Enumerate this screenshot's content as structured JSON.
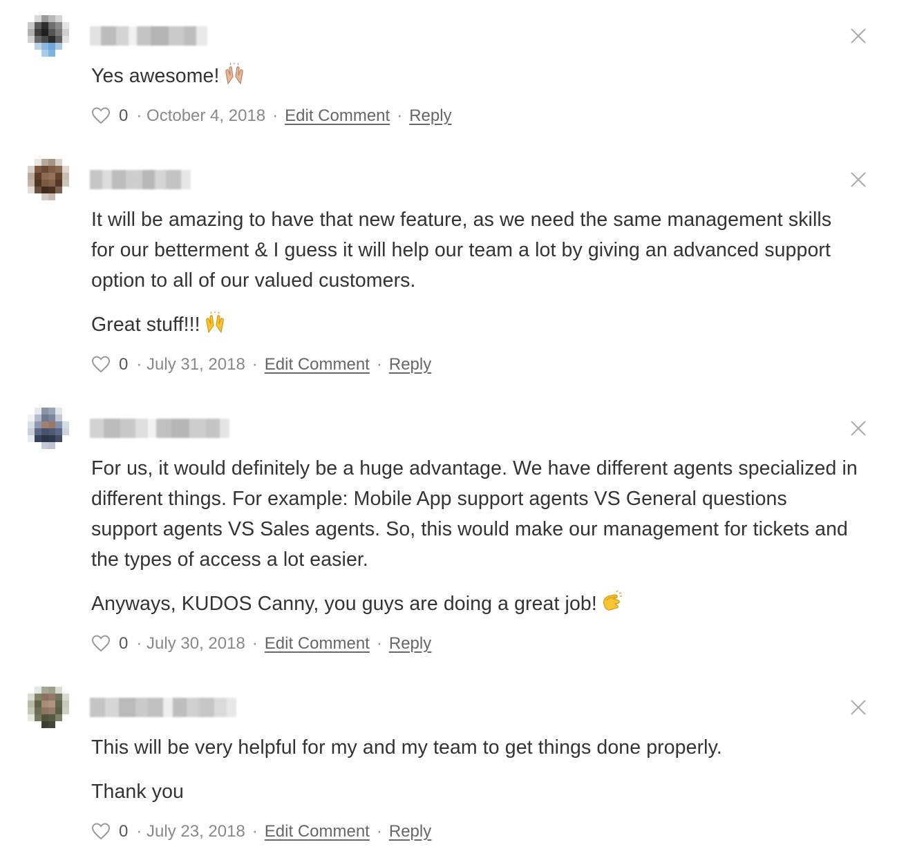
{
  "comments": [
    {
      "paragraphs": [
        "Yes awesome!"
      ],
      "emojis": [
        "raised-hands-light"
      ],
      "likes": "0",
      "date": "· October 4, 2018",
      "edit_label": "Edit Comment",
      "reply_label": "Reply"
    },
    {
      "paragraphs": [
        "It will be amazing to have that new feature, as we need the same management skills for our betterment & I guess it will help our team a lot by giving an advanced support option to all of our valued customers.",
        "Great stuff!!!"
      ],
      "emojis": [
        "raised-hands-yellow"
      ],
      "likes": "0",
      "date": "· July 31, 2018",
      "edit_label": "Edit Comment",
      "reply_label": "Reply"
    },
    {
      "paragraphs": [
        "For us, it would definitely be a huge advantage. We have different agents specialized in different things. For example: Mobile App support agents VS General questions support agents VS Sales agents. So, this would make our management for tickets and the types of access a lot easier.",
        "Anyways, KUDOS Canny, you guys are doing a great job!"
      ],
      "emojis": [
        "clapping-hands"
      ],
      "likes": "0",
      "date": "· July 30, 2018",
      "edit_label": "Edit Comment",
      "reply_label": "Reply"
    },
    {
      "paragraphs": [
        "This will be very helpful for my and my team to get things done properly.",
        "Thank you"
      ],
      "likes": "0",
      "date": "· July 23, 2018",
      "edit_label": "Edit Comment",
      "reply_label": "Reply"
    }
  ],
  "separator": "·",
  "icons": {
    "like": "heart-outline-icon",
    "delete": "close-x-icon"
  },
  "colors": {
    "text": "#333333",
    "meta": "#888888",
    "link": "#666666",
    "icon": "#aaaaaa"
  }
}
